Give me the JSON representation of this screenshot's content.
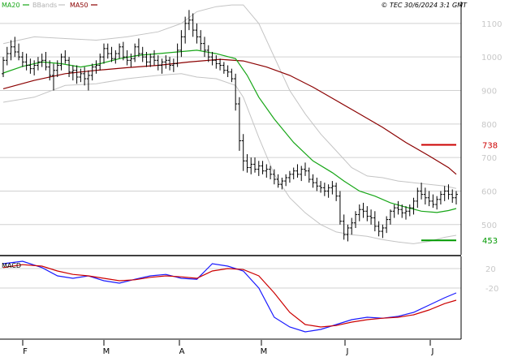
{
  "legend": {
    "items": [
      {
        "label": "MA20",
        "color": "#17a617"
      },
      {
        "label": "BBands",
        "color": "#c0c0c0"
      },
      {
        "label": "MA50",
        "color": "#8b0000"
      }
    ]
  },
  "copyright": "© TEC 30/6/2024 3:1 GMT",
  "macd_title": "MACD",
  "chart_data": [
    {
      "type": "line",
      "panel": "price",
      "x_labels": [
        "F",
        "M",
        "A",
        "M",
        "J",
        "J"
      ],
      "y_ticks": [
        500,
        600,
        700,
        800,
        900,
        1000,
        1100
      ],
      "ylim": [
        410,
        1165
      ],
      "n_bars": 118,
      "bars": [
        [
          950,
          1000,
          940,
          990
        ],
        [
          990,
          1030,
          975,
          1010
        ],
        [
          1010,
          1050,
          990,
          1030
        ],
        [
          1030,
          1060,
          1000,
          1015
        ],
        [
          1015,
          1040,
          990,
          1000
        ],
        [
          1000,
          1015,
          970,
          985
        ],
        [
          985,
          1010,
          960,
          975
        ],
        [
          975,
          995,
          950,
          965
        ],
        [
          965,
          990,
          945,
          975
        ],
        [
          975,
          1000,
          960,
          985
        ],
        [
          985,
          1010,
          970,
          990
        ],
        [
          990,
          1015,
          960,
          970
        ],
        [
          970,
          990,
          930,
          945
        ],
        [
          945,
          980,
          900,
          960
        ],
        [
          960,
          990,
          940,
          975
        ],
        [
          975,
          1010,
          960,
          1000
        ],
        [
          1000,
          1020,
          980,
          990
        ],
        [
          990,
          1000,
          940,
          955
        ],
        [
          955,
          975,
          930,
          960
        ],
        [
          960,
          975,
          920,
          940
        ],
        [
          940,
          965,
          925,
          950
        ],
        [
          950,
          970,
          915,
          935
        ],
        [
          935,
          960,
          900,
          945
        ],
        [
          945,
          980,
          930,
          970
        ],
        [
          970,
          990,
          950,
          975
        ],
        [
          975,
          1010,
          960,
          1000
        ],
        [
          1000,
          1040,
          980,
          1025
        ],
        [
          1025,
          1040,
          995,
          1010
        ],
        [
          1010,
          1030,
          985,
          995
        ],
        [
          995,
          1020,
          980,
          1010
        ],
        [
          1010,
          1040,
          995,
          1030
        ],
        [
          1030,
          1045,
          990,
          1000
        ],
        [
          1000,
          1020,
          975,
          990
        ],
        [
          990,
          1010,
          970,
          995
        ],
        [
          995,
          1040,
          985,
          1030
        ],
        [
          1030,
          1055,
          1000,
          1010
        ],
        [
          1010,
          1030,
          985,
          1000
        ],
        [
          1000,
          1015,
          970,
          985
        ],
        [
          985,
          1010,
          970,
          1000
        ],
        [
          1000,
          1020,
          975,
          990
        ],
        [
          990,
          1005,
          960,
          975
        ],
        [
          975,
          995,
          950,
          985
        ],
        [
          985,
          1005,
          965,
          990
        ],
        [
          990,
          1000,
          960,
          975
        ],
        [
          975,
          995,
          955,
          980
        ],
        [
          980,
          1040,
          970,
          1020
        ],
        [
          1020,
          1080,
          1000,
          1060
        ],
        [
          1060,
          1120,
          1040,
          1100
        ],
        [
          1100,
          1140,
          1080,
          1110
        ],
        [
          1110,
          1130,
          1060,
          1080
        ],
        [
          1080,
          1100,
          1040,
          1060
        ],
        [
          1060,
          1080,
          1020,
          1040
        ],
        [
          1040,
          1060,
          1000,
          1020
        ],
        [
          1020,
          1035,
          985,
          1000
        ],
        [
          1000,
          1015,
          975,
          990
        ],
        [
          990,
          1005,
          965,
          980
        ],
        [
          980,
          995,
          960,
          975
        ],
        [
          975,
          985,
          950,
          960
        ],
        [
          960,
          975,
          940,
          955
        ],
        [
          955,
          965,
          925,
          935
        ],
        [
          935,
          950,
          840,
          860
        ],
        [
          860,
          880,
          720,
          750
        ],
        [
          750,
          770,
          660,
          690
        ],
        [
          690,
          710,
          655,
          670
        ],
        [
          670,
          700,
          650,
          680
        ],
        [
          680,
          700,
          655,
          665
        ],
        [
          665,
          690,
          645,
          675
        ],
        [
          675,
          690,
          650,
          660
        ],
        [
          660,
          680,
          640,
          665
        ],
        [
          665,
          675,
          635,
          650
        ],
        [
          650,
          665,
          620,
          635
        ],
        [
          635,
          650,
          610,
          620
        ],
        [
          620,
          640,
          605,
          630
        ],
        [
          630,
          650,
          615,
          640
        ],
        [
          640,
          660,
          625,
          650
        ],
        [
          650,
          670,
          635,
          660
        ],
        [
          660,
          680,
          640,
          650
        ],
        [
          650,
          675,
          630,
          665
        ],
        [
          665,
          685,
          645,
          660
        ],
        [
          660,
          670,
          625,
          635
        ],
        [
          635,
          650,
          610,
          625
        ],
        [
          625,
          640,
          600,
          615
        ],
        [
          615,
          630,
          595,
          610
        ],
        [
          610,
          625,
          585,
          600
        ],
        [
          600,
          620,
          580,
          610
        ],
        [
          610,
          630,
          590,
          615
        ],
        [
          615,
          625,
          570,
          585
        ],
        [
          585,
          600,
          500,
          510
        ],
        [
          510,
          530,
          455,
          470
        ],
        [
          470,
          500,
          450,
          490
        ],
        [
          490,
          520,
          470,
          505
        ],
        [
          505,
          540,
          490,
          530
        ],
        [
          530,
          560,
          510,
          545
        ],
        [
          545,
          565,
          520,
          540
        ],
        [
          540,
          555,
          510,
          525
        ],
        [
          525,
          545,
          500,
          520
        ],
        [
          520,
          540,
          480,
          495
        ],
        [
          495,
          510,
          465,
          480
        ],
        [
          480,
          500,
          460,
          490
        ],
        [
          490,
          525,
          475,
          515
        ],
        [
          515,
          545,
          500,
          540
        ],
        [
          540,
          560,
          520,
          550
        ],
        [
          550,
          570,
          530,
          545
        ],
        [
          545,
          560,
          520,
          535
        ],
        [
          535,
          555,
          515,
          540
        ],
        [
          540,
          560,
          525,
          550
        ],
        [
          550,
          580,
          530,
          570
        ],
        [
          570,
          610,
          550,
          600
        ],
        [
          600,
          625,
          575,
          590
        ],
        [
          590,
          610,
          560,
          580
        ],
        [
          580,
          600,
          555,
          570
        ],
        [
          570,
          590,
          550,
          560
        ],
        [
          560,
          585,
          545,
          575
        ],
        [
          575,
          600,
          560,
          590
        ],
        [
          590,
          615,
          570,
          600
        ],
        [
          600,
          620,
          575,
          590
        ],
        [
          590,
          605,
          565,
          580
        ],
        [
          580,
          600,
          560,
          590
        ]
      ],
      "ma20": [
        [
          0,
          952
        ],
        [
          5,
          972
        ],
        [
          10,
          985
        ],
        [
          15,
          980
        ],
        [
          20,
          970
        ],
        [
          25,
          980
        ],
        [
          30,
          995
        ],
        [
          35,
          1005
        ],
        [
          40,
          1010
        ],
        [
          45,
          1015
        ],
        [
          50,
          1020
        ],
        [
          55,
          1010
        ],
        [
          60,
          995
        ],
        [
          63,
          945
        ],
        [
          66,
          880
        ],
        [
          70,
          815
        ],
        [
          75,
          745
        ],
        [
          80,
          690
        ],
        [
          85,
          655
        ],
        [
          88,
          630
        ],
        [
          92,
          600
        ],
        [
          96,
          585
        ],
        [
          100,
          565
        ],
        [
          104,
          552
        ],
        [
          108,
          540
        ],
        [
          112,
          536
        ],
        [
          115,
          542
        ],
        [
          117,
          548
        ]
      ],
      "ma50": [
        [
          0,
          905
        ],
        [
          8,
          930
        ],
        [
          16,
          950
        ],
        [
          24,
          960
        ],
        [
          32,
          968
        ],
        [
          40,
          975
        ],
        [
          48,
          985
        ],
        [
          56,
          993
        ],
        [
          62,
          988
        ],
        [
          68,
          970
        ],
        [
          74,
          945
        ],
        [
          80,
          910
        ],
        [
          86,
          870
        ],
        [
          92,
          830
        ],
        [
          98,
          790
        ],
        [
          104,
          745
        ],
        [
          110,
          705
        ],
        [
          115,
          670
        ],
        [
          117,
          650
        ]
      ],
      "bb_upper": [
        [
          0,
          1040
        ],
        [
          8,
          1060
        ],
        [
          16,
          1055
        ],
        [
          24,
          1050
        ],
        [
          32,
          1060
        ],
        [
          40,
          1075
        ],
        [
          46,
          1100
        ],
        [
          50,
          1135
        ],
        [
          55,
          1150
        ],
        [
          59,
          1155
        ],
        [
          62,
          1155
        ],
        [
          66,
          1100
        ],
        [
          70,
          1000
        ],
        [
          74,
          900
        ],
        [
          78,
          830
        ],
        [
          82,
          770
        ],
        [
          86,
          720
        ],
        [
          90,
          670
        ],
        [
          94,
          645
        ],
        [
          98,
          640
        ],
        [
          102,
          630
        ],
        [
          106,
          625
        ],
        [
          110,
          620
        ],
        [
          114,
          615
        ],
        [
          117,
          608
        ]
      ],
      "bb_lower": [
        [
          0,
          865
        ],
        [
          8,
          880
        ],
        [
          16,
          915
        ],
        [
          24,
          920
        ],
        [
          32,
          935
        ],
        [
          40,
          945
        ],
        [
          46,
          950
        ],
        [
          50,
          940
        ],
        [
          55,
          935
        ],
        [
          60,
          915
        ],
        [
          62,
          880
        ],
        [
          66,
          760
        ],
        [
          70,
          650
        ],
        [
          74,
          580
        ],
        [
          78,
          535
        ],
        [
          82,
          500
        ],
        [
          86,
          478
        ],
        [
          90,
          470
        ],
        [
          94,
          465
        ],
        [
          98,
          455
        ],
        [
          102,
          448
        ],
        [
          106,
          443
        ],
        [
          110,
          450
        ],
        [
          114,
          462
        ],
        [
          117,
          468
        ]
      ],
      "annotations": [
        {
          "label": "738",
          "value": 738,
          "color": "#cc0000"
        },
        {
          "label": "453",
          "value": 453,
          "color": "#009900"
        }
      ]
    },
    {
      "type": "line",
      "panel": "macd",
      "title": "MACD",
      "y_ticks": [
        20,
        -20
      ],
      "y_tick_labels": [
        "20",
        "-20"
      ],
      "ylim": [
        -125,
        45
      ],
      "series": [
        {
          "color": "#1a1aff",
          "points": [
            [
              0,
              30
            ],
            [
              5,
              35
            ],
            [
              10,
              22
            ],
            [
              14,
              5
            ],
            [
              18,
              0
            ],
            [
              22,
              5
            ],
            [
              26,
              -5
            ],
            [
              30,
              -10
            ],
            [
              34,
              -2
            ],
            [
              38,
              5
            ],
            [
              42,
              8
            ],
            [
              46,
              0
            ],
            [
              50,
              -2
            ],
            [
              54,
              30
            ],
            [
              58,
              25
            ],
            [
              62,
              15
            ],
            [
              66,
              -20
            ],
            [
              70,
              -80
            ],
            [
              74,
              -100
            ],
            [
              78,
              -110
            ],
            [
              82,
              -105
            ],
            [
              86,
              -95
            ],
            [
              90,
              -85
            ],
            [
              94,
              -80
            ],
            [
              98,
              -82
            ],
            [
              102,
              -78
            ],
            [
              106,
              -70
            ],
            [
              110,
              -55
            ],
            [
              114,
              -40
            ],
            [
              117,
              -30
            ]
          ]
        },
        {
          "color": "#cc0000",
          "points": [
            [
              0,
              22
            ],
            [
              5,
              28
            ],
            [
              10,
              25
            ],
            [
              14,
              15
            ],
            [
              18,
              8
            ],
            [
              22,
              5
            ],
            [
              26,
              0
            ],
            [
              30,
              -5
            ],
            [
              34,
              -3
            ],
            [
              38,
              2
            ],
            [
              42,
              5
            ],
            [
              46,
              3
            ],
            [
              50,
              0
            ],
            [
              54,
              15
            ],
            [
              58,
              20
            ],
            [
              62,
              18
            ],
            [
              66,
              5
            ],
            [
              70,
              -30
            ],
            [
              74,
              -70
            ],
            [
              78,
              -95
            ],
            [
              82,
              -100
            ],
            [
              86,
              -97
            ],
            [
              90,
              -90
            ],
            [
              94,
              -85
            ],
            [
              98,
              -82
            ],
            [
              102,
              -80
            ],
            [
              106,
              -75
            ],
            [
              110,
              -65
            ],
            [
              114,
              -52
            ],
            [
              117,
              -45
            ]
          ]
        }
      ]
    }
  ]
}
